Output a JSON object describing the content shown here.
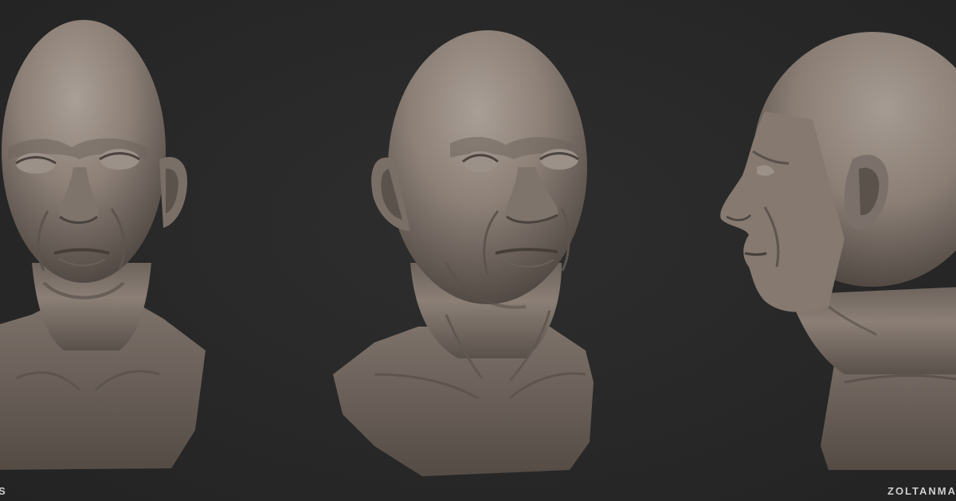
{
  "captions": {
    "left": "S",
    "right": "ZOLTANMAI"
  },
  "colors": {
    "background": "#262626",
    "clay": "#8a7e75",
    "clay_highlight": "#a89d94",
    "clay_shadow": "#4b433e",
    "caption_text": "#cfcfcf"
  }
}
